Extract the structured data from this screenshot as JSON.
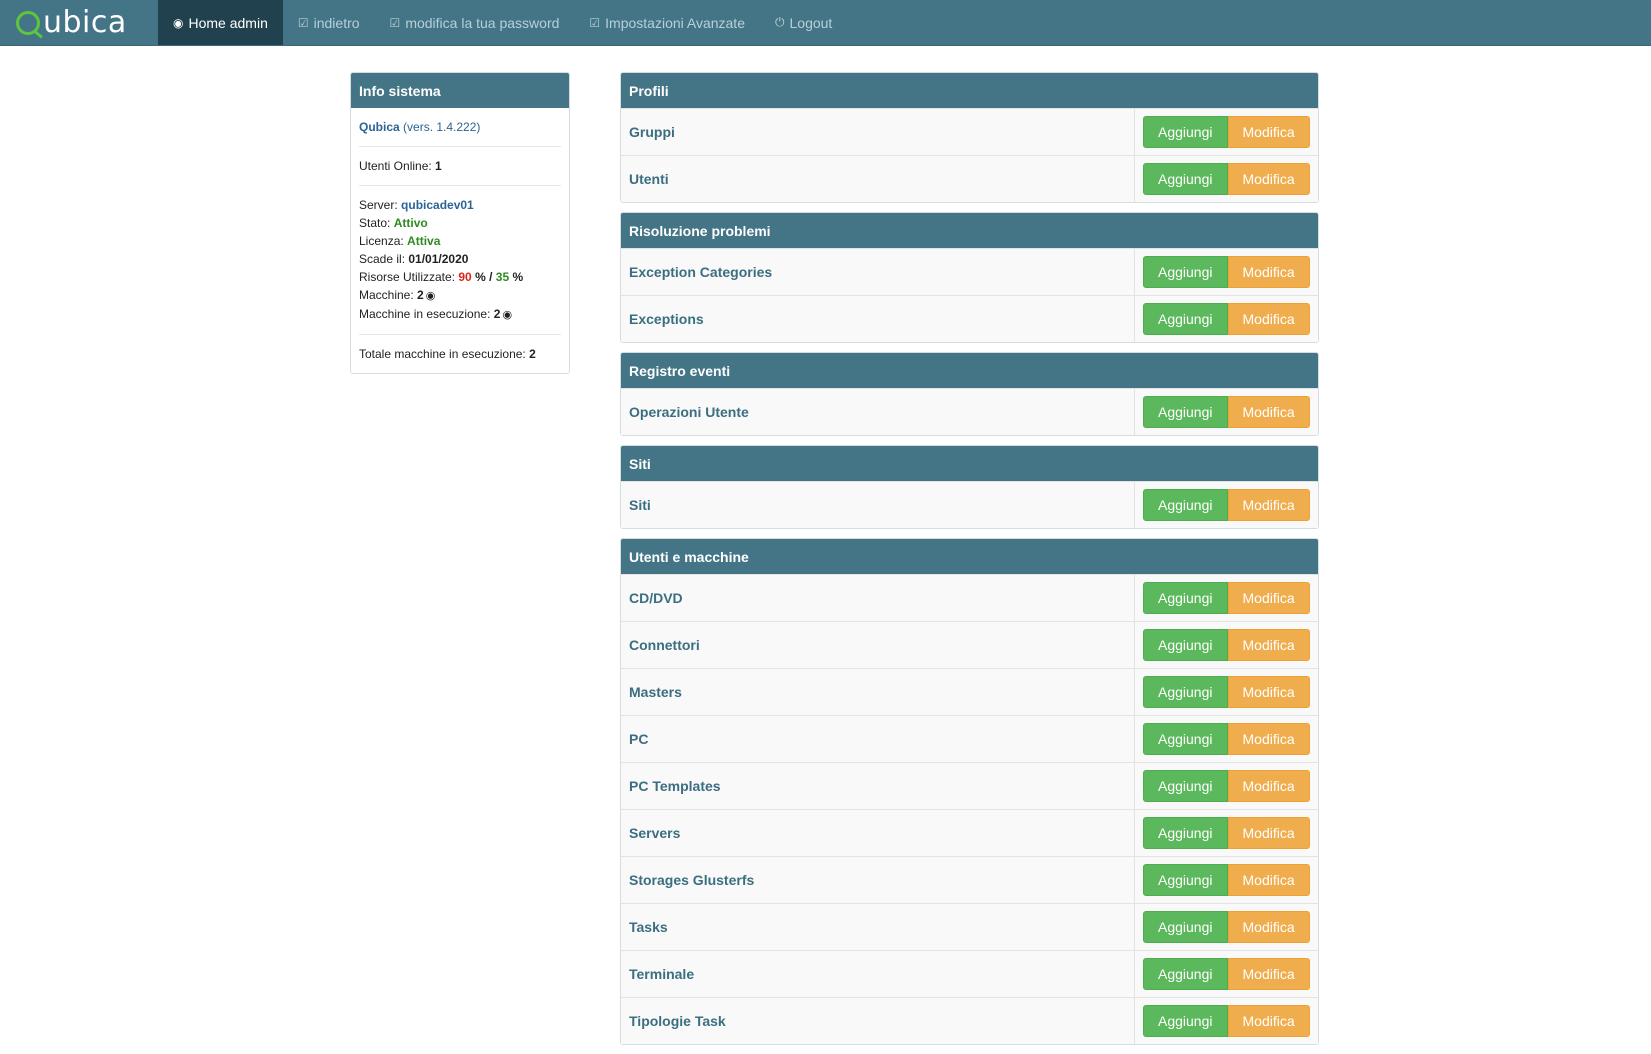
{
  "brand": {
    "text": "ubica"
  },
  "nav": [
    {
      "icon": "◉",
      "label": "Home admin",
      "active": true,
      "name": "nav-home-admin"
    },
    {
      "icon": "☑",
      "label": "indietro",
      "active": false,
      "name": "nav-indietro"
    },
    {
      "icon": "☑",
      "label": "modifica la tua password",
      "active": false,
      "name": "nav-modifica-password"
    },
    {
      "icon": "☑",
      "label": "Impostazioni Avanzate",
      "active": false,
      "name": "nav-impostazioni-avanzate"
    },
    {
      "icon": "⏻",
      "label": "Logout",
      "active": false,
      "name": "nav-logout"
    }
  ],
  "info": {
    "title": "Info sistema",
    "app_name": "Qubica",
    "version": "(vers. 1.4.222)",
    "online_label": "Utenti Online:",
    "online_value": "1",
    "server_label": "Server:",
    "server_value": "qubicadev01",
    "stato_label": "Stato:",
    "stato_value": "Attivo",
    "licenza_label": "Licenza:",
    "licenza_value": "Attiva",
    "scade_label": "Scade il:",
    "scade_value": "01/01/2020",
    "risorse_label": "Risorse Utilizzate:",
    "risorse_a": "90",
    "risorse_sep": "% /",
    "risorse_b": "35",
    "risorse_pct": "%",
    "macchine_label": "Macchine:",
    "macchine_value": "2",
    "exec_label": "Macchine in esecuzione:",
    "exec_value": "2",
    "totale_label": "Totale macchine in esecuzione:",
    "totale_value": "2"
  },
  "buttons": {
    "add": "Aggiungi",
    "edit": "Modifica"
  },
  "groups": [
    {
      "title": "Profili",
      "items": [
        "Gruppi",
        "Utenti"
      ]
    },
    {
      "title": "Risoluzione problemi",
      "items": [
        "Exception Categories",
        "Exceptions"
      ]
    },
    {
      "title": "Registro eventi",
      "items": [
        "Operazioni Utente"
      ]
    },
    {
      "title": "Siti",
      "items": [
        "Siti"
      ]
    },
    {
      "title": "Utenti e macchine",
      "items": [
        "CD/DVD",
        "Connettori",
        "Masters",
        "PC",
        "PC Templates",
        "Servers",
        "Storages Glusterfs",
        "Tasks",
        "Terminale",
        "Tipologie Task"
      ]
    }
  ]
}
